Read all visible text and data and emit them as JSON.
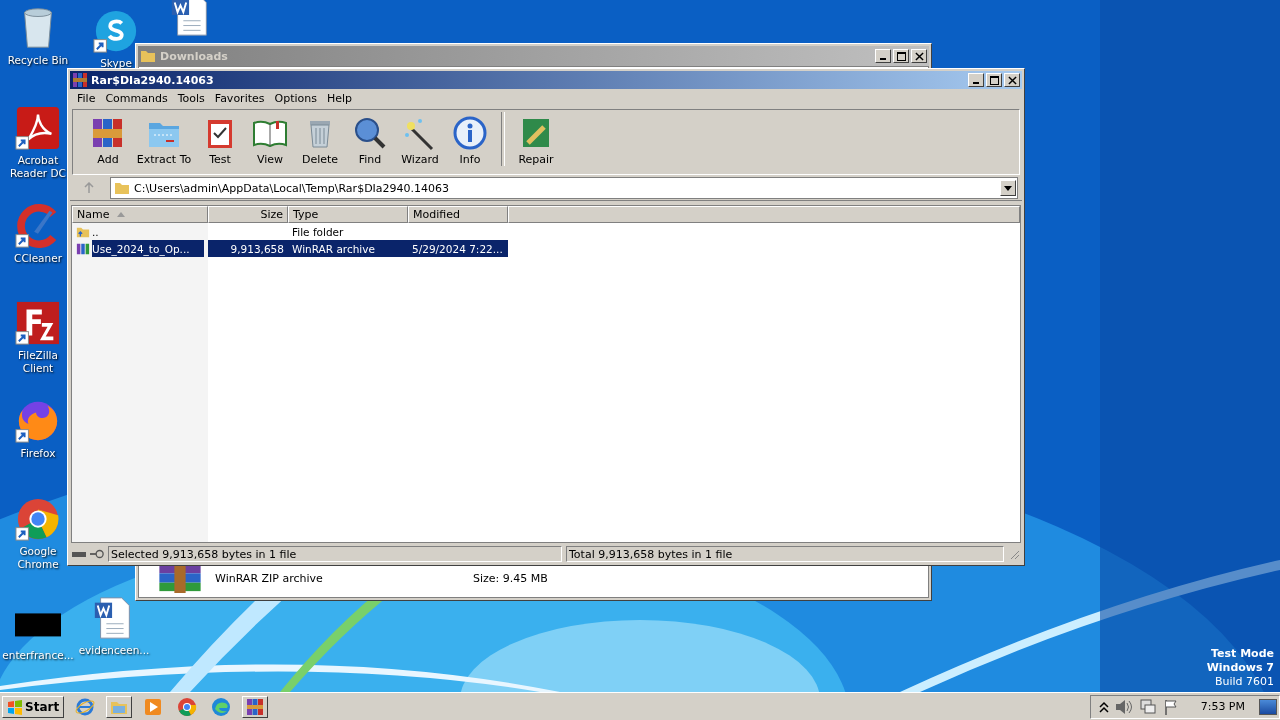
{
  "desktop_icons": [
    {
      "label": "Recycle Bin",
      "kind": "recycle",
      "shortcut": false
    },
    {
      "label": "Skype",
      "kind": "skype",
      "shortcut": true
    },
    {
      "kind": "word",
      "shortcut": false
    },
    {
      "label": "Acrobat Reader DC",
      "kind": "acrobat",
      "shortcut": true
    },
    {
      "label": "CCleaner",
      "kind": "ccleaner",
      "shortcut": true
    },
    {
      "label": "FileZilla Client",
      "kind": "filezilla",
      "shortcut": true
    },
    {
      "label": "Firefox",
      "kind": "firefox",
      "shortcut": true
    },
    {
      "label": "Google Chrome",
      "kind": "chrome",
      "shortcut": true
    },
    {
      "label": "enterfrance...",
      "kind": "blank",
      "shortcut": false
    },
    {
      "label": "evidenceen...",
      "kind": "word",
      "shortcut": false
    }
  ],
  "downloads_window": {
    "title": "Downloads",
    "file_type": "WinRAR ZIP archive",
    "file_size": "Size: 9.45 MB"
  },
  "winrar_window": {
    "title": "Rar$DIa2940.14063",
    "menu": [
      "File",
      "Commands",
      "Tools",
      "Favorites",
      "Options",
      "Help"
    ],
    "toolbar": [
      {
        "label": "Add",
        "kind": "add"
      },
      {
        "label": "Extract To",
        "kind": "extract"
      },
      {
        "label": "Test",
        "kind": "test"
      },
      {
        "label": "View",
        "kind": "view"
      },
      {
        "label": "Delete",
        "kind": "delete"
      },
      {
        "label": "Find",
        "kind": "find"
      },
      {
        "label": "Wizard",
        "kind": "wizard"
      },
      {
        "label": "Info",
        "kind": "info"
      },
      {
        "label": "Repair",
        "kind": "repair"
      }
    ],
    "path": "C:\\Users\\admin\\AppData\\Local\\Temp\\Rar$DIa2940.14063",
    "columns": [
      {
        "label": "Name",
        "sorted": true
      },
      {
        "label": "Size",
        "sorted": false
      },
      {
        "label": "Type",
        "sorted": false
      },
      {
        "label": "Modified",
        "sorted": false
      }
    ],
    "rows": [
      {
        "name": "..",
        "type": "File folder",
        "kind": "folder",
        "selected": false
      },
      {
        "name": "Use_2024_to_Op...",
        "size": "9,913,658",
        "type": "WinRAR archive",
        "modified": "5/29/2024 7:22...",
        "kind": "archive",
        "selected": true
      }
    ],
    "status_bar": {
      "selected": "Selected 9,913,658 bytes in 1 file",
      "total": "Total 9,913,658 bytes in 1 file"
    }
  },
  "os_notice": [
    "Test Mode",
    "Windows 7",
    "Build 7601"
  ],
  "taskbar": {
    "start": "Start",
    "apps": [
      {
        "kind": "ie",
        "active": false
      },
      {
        "kind": "explorer",
        "active": true
      },
      {
        "kind": "media",
        "active": false
      },
      {
        "kind": "chrome",
        "active": false
      },
      {
        "kind": "edge",
        "active": false
      },
      {
        "kind": "winrar",
        "active": true
      }
    ],
    "clock": "7:53 PM"
  }
}
